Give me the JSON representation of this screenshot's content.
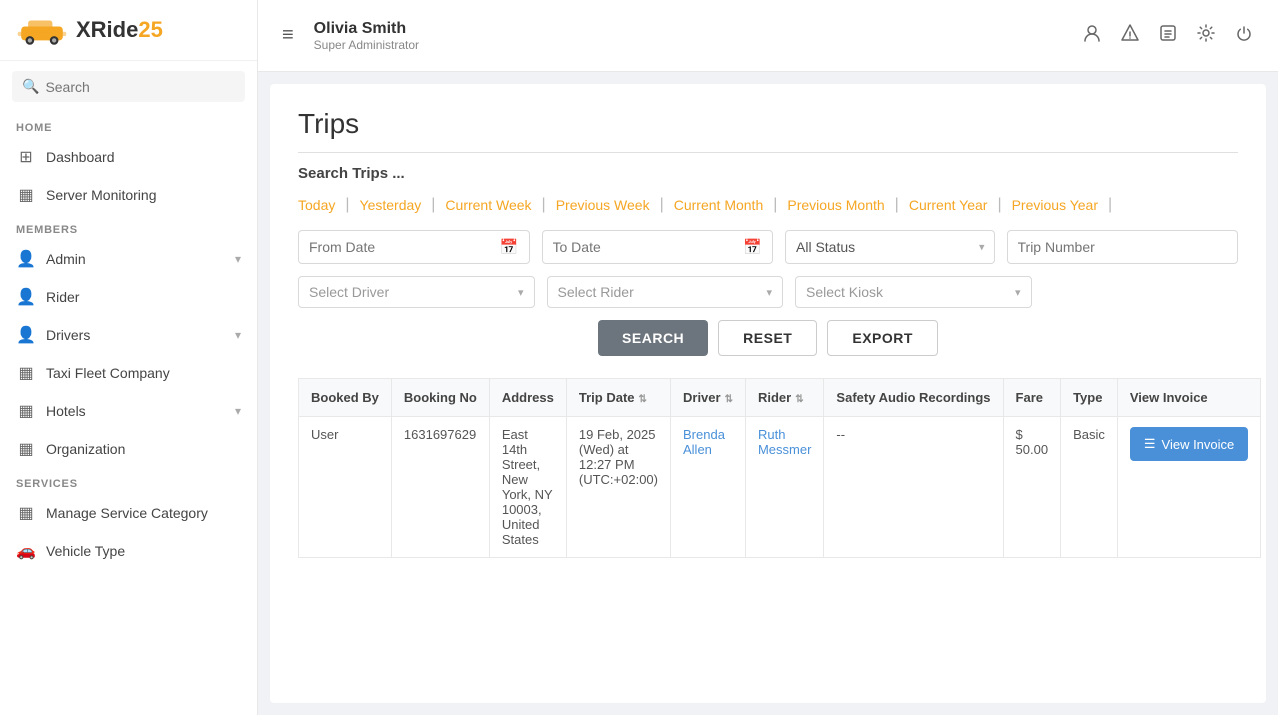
{
  "sidebar": {
    "logo_text": "XRide",
    "logo_accent": "25",
    "search_placeholder": "Search",
    "sections": [
      {
        "title": "HOME",
        "items": [
          {
            "label": "Dashboard",
            "icon": "⊞"
          },
          {
            "label": "Server Monitoring",
            "icon": "▦"
          }
        ]
      },
      {
        "title": "MEMBERS",
        "items": [
          {
            "label": "Admin",
            "icon": "👤",
            "has_chevron": true
          },
          {
            "label": "Rider",
            "icon": "👤"
          },
          {
            "label": "Drivers",
            "icon": "👤",
            "has_chevron": true
          },
          {
            "label": "Taxi Fleet Company",
            "icon": "▦"
          },
          {
            "label": "Hotels",
            "icon": "▦",
            "has_chevron": true
          },
          {
            "label": "Organization",
            "icon": "▦"
          }
        ]
      },
      {
        "title": "SERVICES",
        "items": [
          {
            "label": "Manage Service Category",
            "icon": "▦"
          },
          {
            "label": "Vehicle Type",
            "icon": "🚗"
          }
        ]
      }
    ]
  },
  "header": {
    "user_name": "Olivia Smith",
    "user_role": "Super Administrator",
    "menu_icon": "≡"
  },
  "page": {
    "title": "Trips",
    "search_section_title": "Search Trips ...",
    "filter_links": [
      "Today",
      "Yesterday",
      "Current Week",
      "Previous Week",
      "Current Month",
      "Previous Month",
      "Current Year",
      "Previous Year"
    ],
    "filters": {
      "from_date_placeholder": "From Date",
      "to_date_placeholder": "To Date",
      "status_default": "All Status",
      "trip_number_placeholder": "Trip Number",
      "select_driver": "Select Driver",
      "select_rider": "Select Rider",
      "select_kiosk": "Select Kiosk"
    },
    "buttons": {
      "search": "SEARCH",
      "reset": "RESET",
      "export": "EXPORT"
    },
    "table": {
      "headers": [
        {
          "label": "Booked By",
          "sortable": false
        },
        {
          "label": "Booking No",
          "sortable": false
        },
        {
          "label": "Address",
          "sortable": false
        },
        {
          "label": "Trip Date",
          "sortable": true
        },
        {
          "label": "Driver",
          "sortable": true
        },
        {
          "label": "Rider",
          "sortable": true
        },
        {
          "label": "Safety Audio Recordings",
          "sortable": false
        },
        {
          "label": "Fare",
          "sortable": false
        },
        {
          "label": "Type",
          "sortable": false
        },
        {
          "label": "View Invoice",
          "sortable": false
        }
      ],
      "rows": [
        {
          "booked_by": "User",
          "booking_no": "1631697629",
          "address": "East 14th Street, New York, NY 10003, United States",
          "trip_date": "19 Feb, 2025 (Wed) at 12:27 PM (UTC:+02:00)",
          "driver": "Brenda Allen",
          "driver_link": "#",
          "rider": "Ruth Messmer",
          "rider_link": "#",
          "safety_audio": "--",
          "fare": "$ 50.00",
          "type": "Basic",
          "view_invoice_label": "View Invoice"
        }
      ]
    }
  }
}
